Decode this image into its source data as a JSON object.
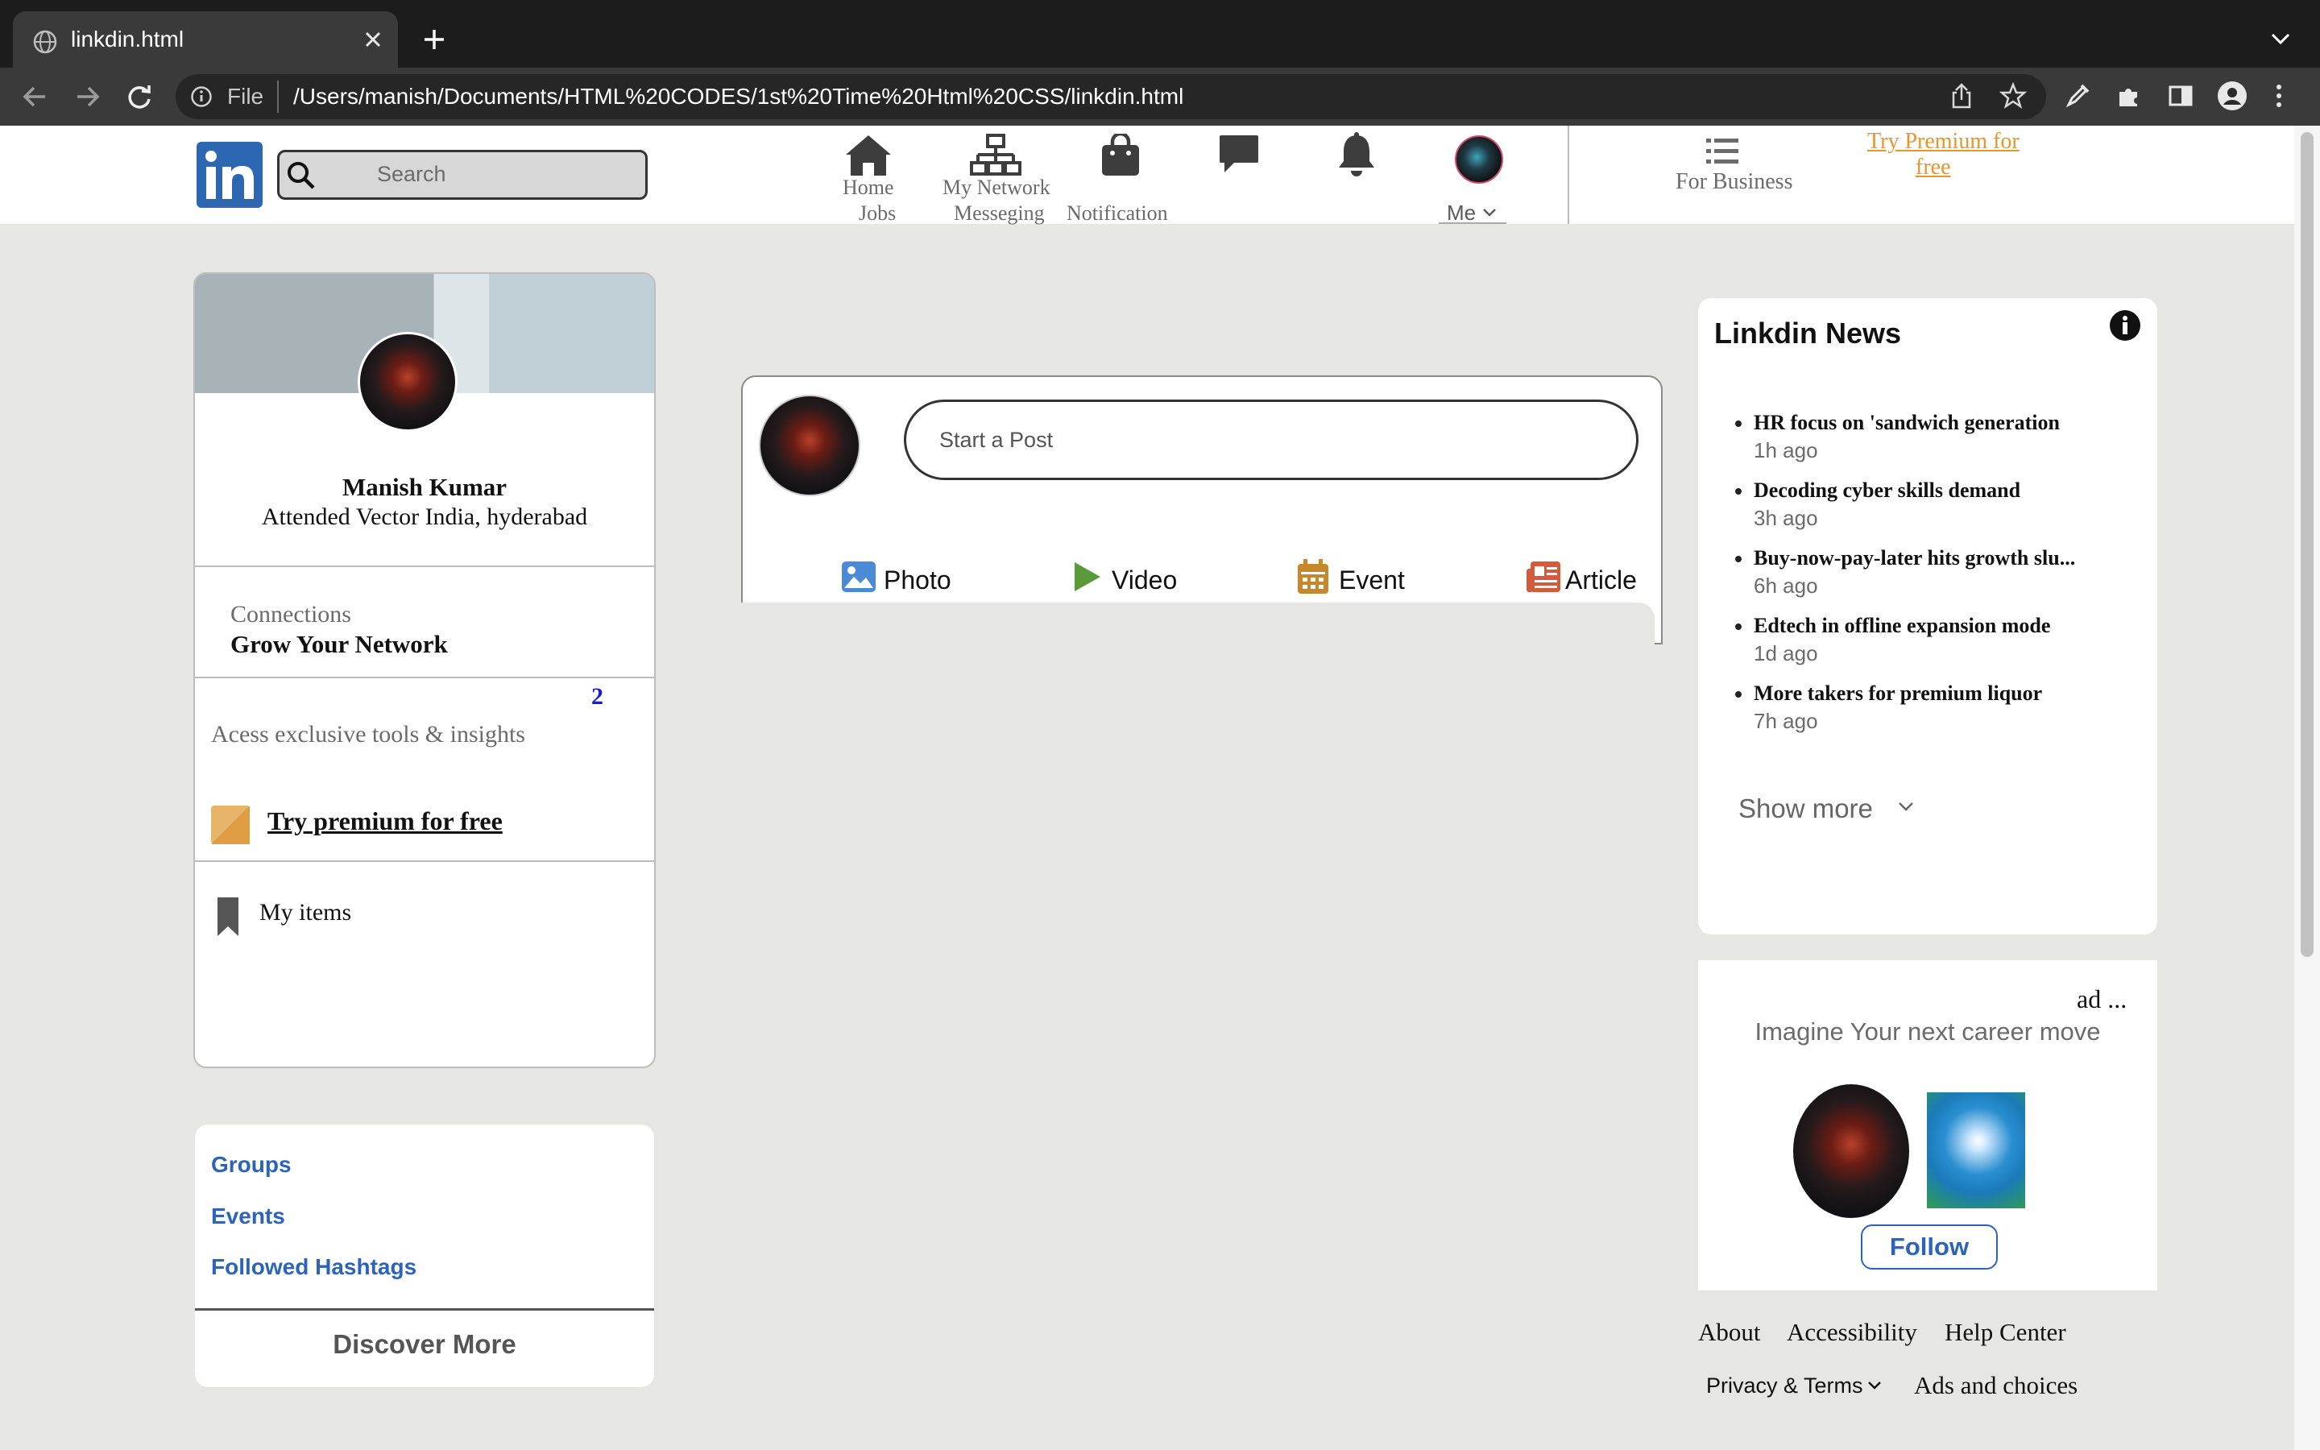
{
  "browser": {
    "tab_title": "linkdin.html",
    "file_label": "File",
    "url": "/Users/manish/Documents/HTML%20CODES/1st%20Time%20Html%20CSS/linkdin.html"
  },
  "nav": {
    "search_placeholder": "Search",
    "home_label": "Home",
    "jobs_label": "Jobs",
    "network_label": "My Network",
    "messaging_label": "Messeging",
    "notification_label": "Notification",
    "me_label": "Me",
    "business_label": "For Business",
    "premium_link_line1": "Try Premium for",
    "premium_link_line2": "free"
  },
  "profile": {
    "name": "Manish Kumar",
    "subtitle": "Attended Vector India, hyderabad",
    "connections_label": "Connections",
    "grow_network": "Grow Your Network",
    "count": "2",
    "access_tools": "Acess exclusive tools & insights",
    "try_premium": "Try premium for free",
    "my_items": "My items"
  },
  "links": {
    "groups": "Groups",
    "events": "Events",
    "hashtags": "Followed Hashtags",
    "discover": "Discover More"
  },
  "post": {
    "placeholder": "Start a Post",
    "photo": "Photo",
    "video": "Video",
    "event": "Event",
    "article": "Article"
  },
  "news": {
    "title": "Linkdin News",
    "items": [
      {
        "headline": "HR focus on 'sandwich generation",
        "time": "1h ago"
      },
      {
        "headline": "Decoding cyber skills demand",
        "time": "3h ago"
      },
      {
        "headline": "Buy-now-pay-later hits growth slu...",
        "time": "6h ago"
      },
      {
        "headline": "Edtech in offline expansion mode",
        "time": "1d ago"
      },
      {
        "headline": "More takers for premium liquor",
        "time": "7h ago"
      }
    ],
    "show_more": "Show more"
  },
  "ad": {
    "label": "ad ...",
    "tagline": "Imagine Your next career move",
    "follow": "Follow"
  },
  "footer": {
    "about": "About",
    "accessibility": "Accessibility",
    "help": "Help Center",
    "privacy": "Privacy & Terms",
    "ads": "Ads and choices"
  },
  "colors": {
    "linkedin_blue": "#2d67b1",
    "premium_orange": "#e8962a",
    "link_blue": "#2c64b8",
    "photo_icon": "#4b8bd6",
    "video_icon": "#5a9a3a",
    "event_icon": "#c8882a",
    "article_icon": "#d35a3a"
  },
  "icons": [
    "globe-icon",
    "close-icon",
    "plus-icon",
    "chevron-down-icon",
    "back-arrow-icon",
    "forward-arrow-icon",
    "reload-icon",
    "info-icon",
    "share-icon",
    "star-icon",
    "pen-icon",
    "puzzle-icon",
    "sidebar-icon",
    "profile-icon",
    "kebab-menu-icon",
    "linkedin-logo",
    "search-icon",
    "home-icon",
    "network-icon",
    "briefcase-icon",
    "message-icon",
    "bell-icon",
    "grid-menu-icon",
    "bookmark-icon",
    "premium-badge-icon",
    "photo-icon",
    "video-icon",
    "event-icon",
    "article-icon"
  ]
}
